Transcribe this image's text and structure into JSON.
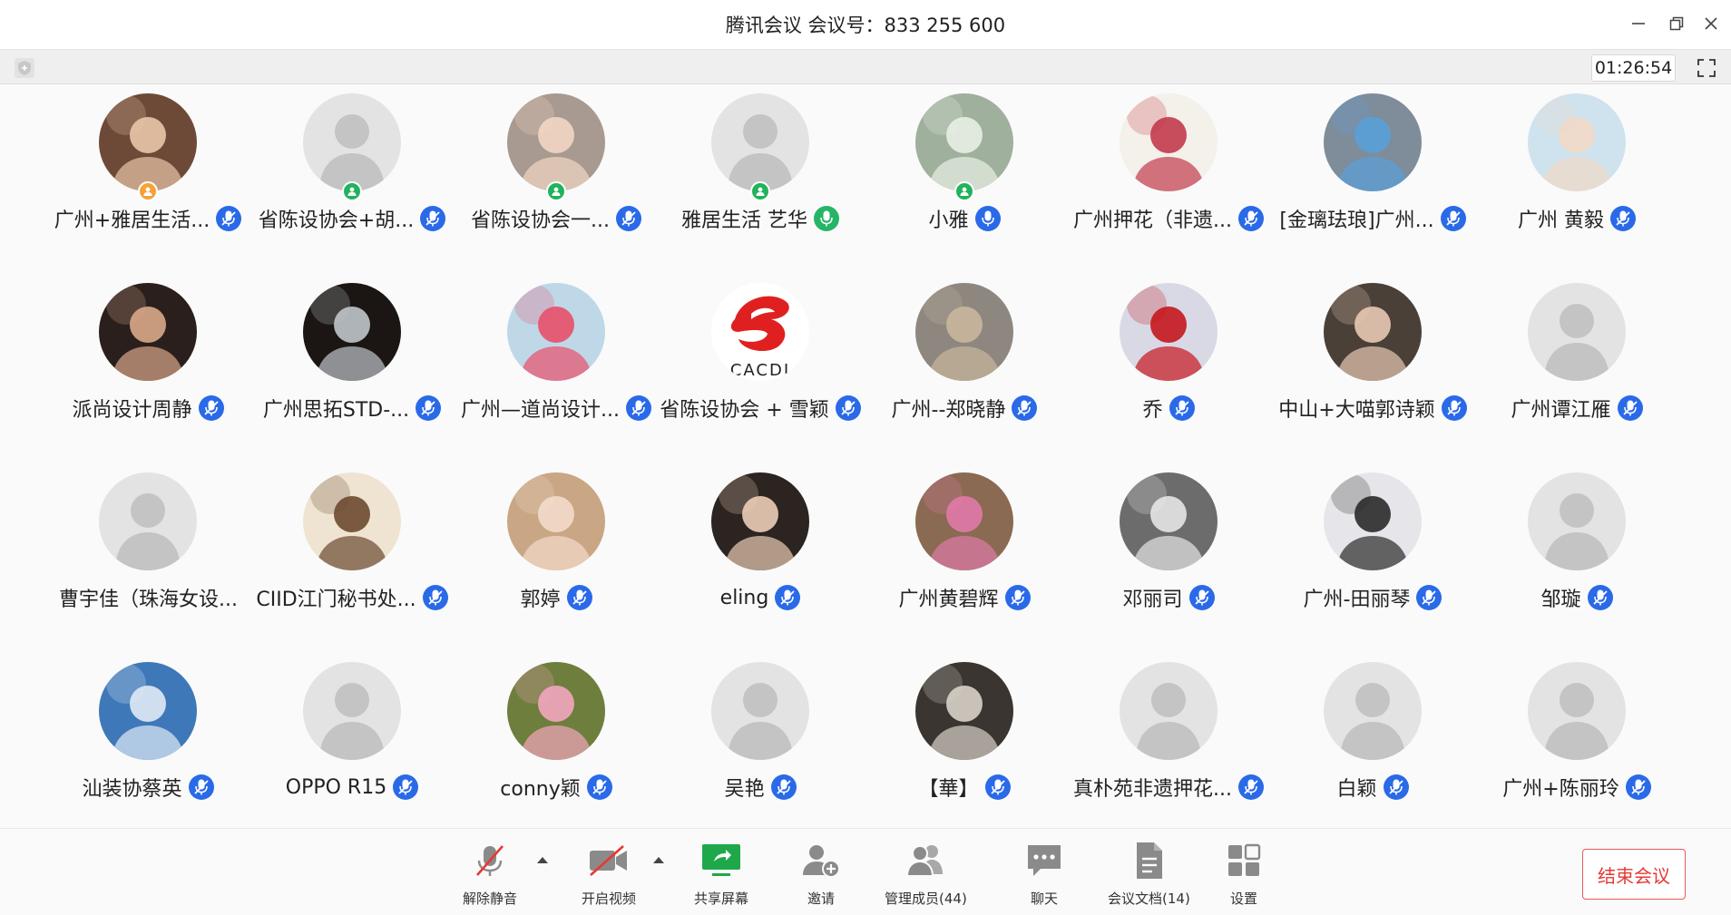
{
  "window": {
    "title": "腾讯会议 会议号：833 255 600",
    "timer": "01:26:54"
  },
  "participants": [
    {
      "name": "广州+雅居生活...",
      "avatar": "photo",
      "bg": "#6d4a38",
      "fg": "#e9c6a8",
      "mic": "blue",
      "badge": "host"
    },
    {
      "name": "省陈设协会+胡...",
      "avatar": "default",
      "mic": "blue",
      "badge": "cohost"
    },
    {
      "name": "省陈设协会一...",
      "avatar": "photo",
      "bg": "#a89a90",
      "fg": "#f2d6c4",
      "mic": "blue",
      "badge": "cohost"
    },
    {
      "name": "雅居生活 艺华",
      "avatar": "default",
      "mic": "green",
      "badge": "cohost"
    },
    {
      "name": "小雅",
      "avatar": "photo",
      "bg": "#9fb09c",
      "fg": "#e8efe6",
      "mic": "blue-on",
      "badge": "cohost"
    },
    {
      "name": "广州押花（非遗...",
      "avatar": "photo",
      "bg": "#f4f0ea",
      "fg": "#c23a4c",
      "mic": "blue",
      "badge": "none"
    },
    {
      "name": "[金璃珐琅]广州...",
      "avatar": "photo",
      "bg": "#7f8c9a",
      "fg": "#5aa0d8",
      "mic": "blue",
      "badge": "none"
    },
    {
      "name": "广州 黄毅",
      "avatar": "photo",
      "bg": "#cfe3ee",
      "fg": "#f1d9c6",
      "mic": "blue",
      "badge": "none"
    },
    {
      "name": "派尚设计周静",
      "avatar": "photo",
      "bg": "#2a1f1c",
      "fg": "#d9a78a",
      "mic": "blue",
      "badge": "none"
    },
    {
      "name": "广州思拓STD-...",
      "avatar": "photo",
      "bg": "#1b1614",
      "fg": "#bfc5c9",
      "mic": "blue",
      "badge": "none"
    },
    {
      "name": "广州—道尚设计...",
      "avatar": "photo",
      "bg": "#bfd8e8",
      "fg": "#e8506a",
      "mic": "blue",
      "badge": "none"
    },
    {
      "name": "省陈设协会 + 雪颖",
      "avatar": "logo",
      "bg": "#ffffff",
      "fg": "#e02020",
      "mic": "blue",
      "badge": "none"
    },
    {
      "name": "广州--郑晓静",
      "avatar": "photo",
      "bg": "#8d8780",
      "fg": "#c9b69c",
      "mic": "blue",
      "badge": "none"
    },
    {
      "name": "乔",
      "avatar": "photo",
      "bg": "#d9d9e6",
      "fg": "#c4161c",
      "mic": "blue",
      "badge": "none"
    },
    {
      "name": "中山+大喵郭诗颖",
      "avatar": "photo",
      "bg": "#4a4038",
      "fg": "#e8c9b3",
      "mic": "blue",
      "badge": "none"
    },
    {
      "name": "广州谭江雁",
      "avatar": "default",
      "mic": "blue",
      "badge": "none"
    },
    {
      "name": "曹宇佳（珠海女设...",
      "avatar": "default",
      "mic": "none",
      "badge": "none"
    },
    {
      "name": "CIID江门秘书处...",
      "avatar": "photo",
      "bg": "#efe4d2",
      "fg": "#6b4a30",
      "mic": "blue",
      "badge": "none"
    },
    {
      "name": "郭婷",
      "avatar": "photo",
      "bg": "#c9a684",
      "fg": "#f3dccb",
      "mic": "blue",
      "badge": "none"
    },
    {
      "name": "eling",
      "avatar": "photo",
      "bg": "#2b2420",
      "fg": "#eccdb6",
      "mic": "blue",
      "badge": "none"
    },
    {
      "name": "广州黄碧辉",
      "avatar": "photo",
      "bg": "#8a6a52",
      "fg": "#e07aa8",
      "mic": "blue",
      "badge": "none"
    },
    {
      "name": "邓丽司",
      "avatar": "photo",
      "bg": "#6c6c6c",
      "fg": "#e6e6e6",
      "mic": "blue",
      "badge": "none"
    },
    {
      "name": "广州-田丽琴",
      "avatar": "photo",
      "bg": "#e6e6ea",
      "fg": "#2a2a2a",
      "mic": "blue",
      "badge": "none"
    },
    {
      "name": "邹璇",
      "avatar": "default",
      "mic": "blue",
      "badge": "none"
    },
    {
      "name": "汕装协蔡英",
      "avatar": "photo",
      "bg": "#3f78b8",
      "fg": "#dfeaf5",
      "mic": "blue",
      "badge": "none"
    },
    {
      "name": "OPPO R15",
      "avatar": "default",
      "mic": "blue",
      "badge": "none"
    },
    {
      "name": "conny颖",
      "avatar": "photo",
      "bg": "#6e7e3c",
      "fg": "#f2a6be",
      "mic": "blue",
      "badge": "none"
    },
    {
      "name": "吴艳",
      "avatar": "default",
      "mic": "blue",
      "badge": "none"
    },
    {
      "name": "【華】",
      "avatar": "photo",
      "bg": "#3a3530",
      "fg": "#d8d2c8",
      "mic": "blue",
      "badge": "none"
    },
    {
      "name": "真朴苑非遗押花...",
      "avatar": "default",
      "mic": "blue",
      "badge": "none"
    },
    {
      "name": "白颖",
      "avatar": "default",
      "mic": "blue",
      "badge": "none"
    },
    {
      "name": "广州+陈丽玲",
      "avatar": "default",
      "mic": "blue",
      "badge": "none"
    }
  ],
  "logo_text": "CACDI",
  "toolbar": {
    "unmute": "解除静音",
    "video": "开启视频",
    "share": "共享屏幕",
    "invite": "邀请",
    "members": "管理成员(44)",
    "chat": "聊天",
    "docs": "会议文档(14)",
    "settings": "设置",
    "end": "结束会议"
  },
  "colors": {
    "mic_blue": "#2a6ae8",
    "mic_green": "#26b566",
    "share_green": "#1fa84a",
    "end_red": "#e53935",
    "default_avatar_bg": "#e3e3e3",
    "default_avatar_fg": "#c4c4c4"
  }
}
